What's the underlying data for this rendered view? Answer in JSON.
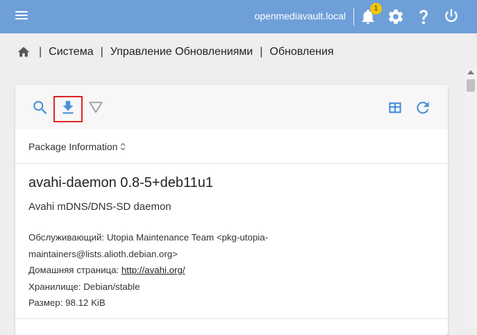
{
  "topbar": {
    "hostname": "openmediavault.local",
    "notification_count": "1",
    "bg_color": "#6e9fd8",
    "icons": [
      "menu-icon",
      "bell-icon",
      "gear-icon",
      "help-icon",
      "power-icon"
    ]
  },
  "breadcrumb": {
    "items": [
      "Система",
      "Управление Обновлениями",
      "Обновления"
    ],
    "separator": "|"
  },
  "toolbar": {
    "icons": [
      "search-icon",
      "download-icon",
      "filter-icon",
      "table-columns-icon",
      "refresh-icon"
    ],
    "accent_color": "#4a90d9",
    "highlight_color": "#e02424"
  },
  "table": {
    "column_header": "Package Information"
  },
  "package": {
    "name": "avahi-daemon 0.8-5+deb11u1",
    "description": "Avahi mDNS/DNS-SD daemon",
    "maintainer_label": "Обслуживающий: ",
    "maintainer_value_line1": "Utopia Maintenance Team <pkg-utopia-",
    "maintainer_value_line2": "maintainers@lists.alioth.debian.org>",
    "homepage_label": "Домашняя страница: ",
    "homepage_url": "http://avahi.org/",
    "repository_label": "Хранилище: ",
    "repository_value": "Debian/stable",
    "size_label": "Размер: ",
    "size_value": "98.12 KiB"
  }
}
